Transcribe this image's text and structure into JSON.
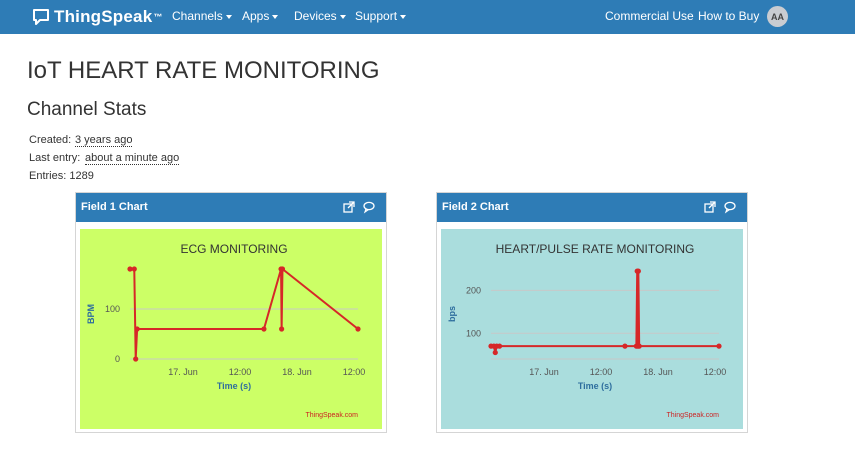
{
  "nav": {
    "brand": "ThingSpeak",
    "brand_tm": "™",
    "channels": "Channels",
    "apps": "Apps",
    "devices": "Devices",
    "support": "Support",
    "commercial": "Commercial Use",
    "how_to_buy": "How to Buy",
    "avatar": "AA"
  },
  "page": {
    "title": "IoT HEART RATE MONITORING",
    "stats_title": "Channel Stats",
    "created_label": "Created:",
    "created_value": "3 years ago",
    "last_entry_label": "Last entry:",
    "last_entry_value": "about a minute ago",
    "entries": "Entries: 1289"
  },
  "panels": [
    {
      "title": "Field 1 Chart",
      "bg": "#ccff66"
    },
    {
      "title": "Field 2 Chart",
      "bg": "#aadddd"
    }
  ],
  "colors": {
    "nav": "#2e7cb6",
    "line": "#d62728"
  },
  "chart_data": [
    {
      "type": "line",
      "title": "ECG MONITORING",
      "xlabel": "Time (s)",
      "ylabel": "BPM",
      "credit": "ThingSpeak.com",
      "x_ticks": [
        "17. Jun",
        "12:00",
        "18. Jun",
        "12:00"
      ],
      "y_ticks": [
        "0",
        "100"
      ],
      "ylim": [
        0,
        180
      ],
      "grid": true,
      "x": [
        0,
        0.15,
        0.2,
        0.25,
        4.7,
        5.3,
        5.32,
        5.35,
        8.0
      ],
      "y": [
        180,
        180,
        0,
        60,
        60,
        180,
        60,
        180,
        60
      ]
    },
    {
      "type": "line",
      "title": "HEART/PULSE RATE MONITORING",
      "xlabel": "Time (s)",
      "ylabel": "bps",
      "credit": "ThingSpeak.com",
      "x_ticks": [
        "17. Jun",
        "12:00",
        "18. Jun",
        "12:00"
      ],
      "y_ticks": [
        "100",
        "200"
      ],
      "ylim": [
        40,
        250
      ],
      "grid": true,
      "x": [
        0,
        0.1,
        0.15,
        0.2,
        0.3,
        4.7,
        5.1,
        5.13,
        5.15,
        5.17,
        5.2,
        8.0
      ],
      "y": [
        70,
        70,
        55,
        70,
        70,
        70,
        70,
        245,
        70,
        245,
        70,
        70
      ]
    }
  ]
}
